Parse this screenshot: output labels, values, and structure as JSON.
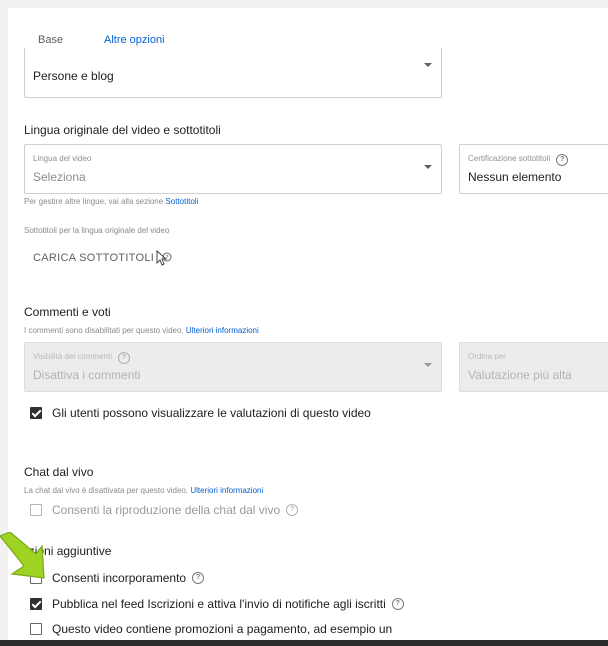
{
  "tabs": [
    {
      "label": "Base",
      "active": false
    },
    {
      "label": "Altre opzioni",
      "active": true
    }
  ],
  "category": {
    "value": "Persone e blog"
  },
  "language_section": {
    "title": "Lingua originale del video e sottotitoli",
    "video_language": {
      "label": "Lingua del video",
      "value": "Seleziona"
    },
    "caption_cert": {
      "label": "Certificazione sottotitoli",
      "value": "Nessun elemento"
    },
    "helper_text": "Per gestire altre lingue, vai alla sezione",
    "helper_link": "Sottotitoli",
    "subtitles_caption": "Sottotitoli per la lingua originale del video",
    "upload_button": "CARICA SOTTOTITOLI"
  },
  "comments_section": {
    "title": "Commenti e voti",
    "helper_text": "I commenti sono disabilitati per questo video.",
    "helper_link": "Ulteriori informazioni",
    "visibility": {
      "label": "Visibilità dei commenti",
      "value": "Disattiva i commenti"
    },
    "sort": {
      "label": "Ordina per",
      "value": "Valutazione più alta"
    },
    "ratings_checkbox": {
      "label": "Gli utenti possono visualizzare le valutazioni di questo video",
      "checked": true
    }
  },
  "chat_section": {
    "title": "Chat dal vivo",
    "helper_text": "La chat dal vivo è disattivata per questo video.",
    "helper_link": "Ulteriori informazioni",
    "replay_checkbox": {
      "label": "Consenti la riproduzione della chat dal vivo",
      "checked": false
    }
  },
  "additional_section": {
    "title": "pzioni aggiuntive",
    "embed_checkbox": {
      "label": "Consenti incorporamento",
      "checked": false
    },
    "notify_checkbox": {
      "label": "Pubblica nel feed Iscrizioni e attiva l'invio di notifiche agli iscritti",
      "checked": true
    },
    "promo_checkbox": {
      "label": "Questo video contiene promozioni a pagamento, ad esempio un",
      "checked": false
    }
  },
  "colors": {
    "accent": "#065fd4",
    "arrow": "#9ed321"
  }
}
